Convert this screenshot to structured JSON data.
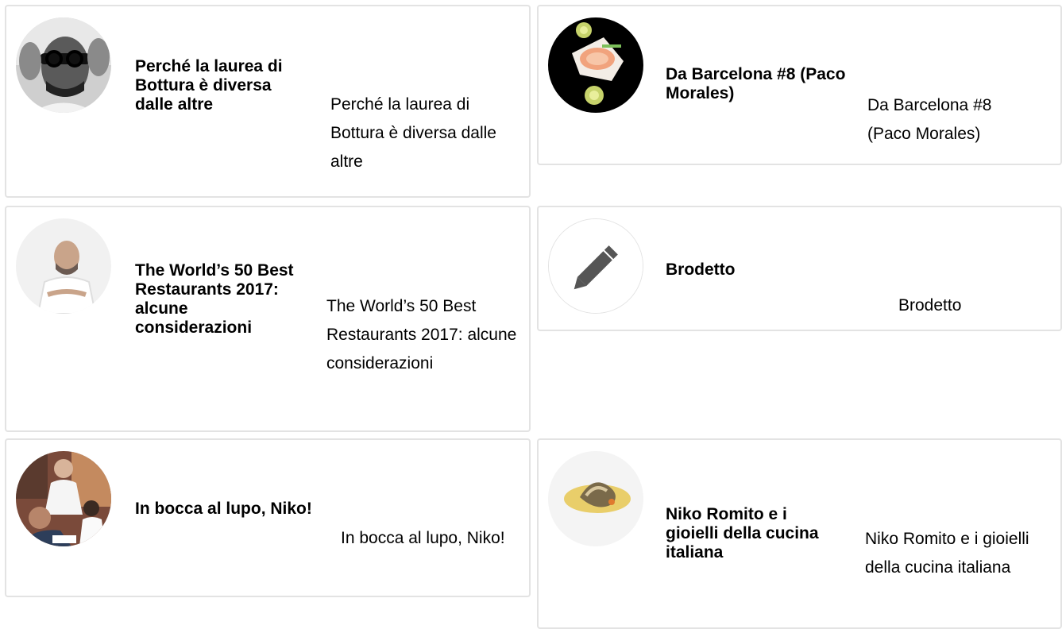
{
  "posts": [
    {
      "title": "Perché la laurea di Bottura è diversa dalle altre",
      "excerpt": "Perché la laurea di Bottura è diversa dalle altre",
      "thumbnail": "portrait-photo"
    },
    {
      "title": "Da Barcelona #8 (Paco Morales)",
      "excerpt": "Da Barcelona #8 (Paco Morales)",
      "thumbnail": "food-photo"
    },
    {
      "title": "The World’s 50 Best Restaurants 2017: alcune considerazioni",
      "excerpt": "The World’s 50 Best Restaurants 2017: alcune considerazioni",
      "thumbnail": "chef-photo"
    },
    {
      "title": "Brodetto",
      "excerpt": "Brodetto",
      "thumbnail": "pencil-icon"
    },
    {
      "title": "In bocca al lupo, Niko!",
      "excerpt": "In bocca al lupo, Niko!",
      "thumbnail": "people-photo"
    },
    {
      "title": "Niko Romito e i gioielli della cucina italiana",
      "excerpt": "Niko Romito e i gioielli della cucina italiana",
      "thumbnail": "dish-photo"
    }
  ]
}
